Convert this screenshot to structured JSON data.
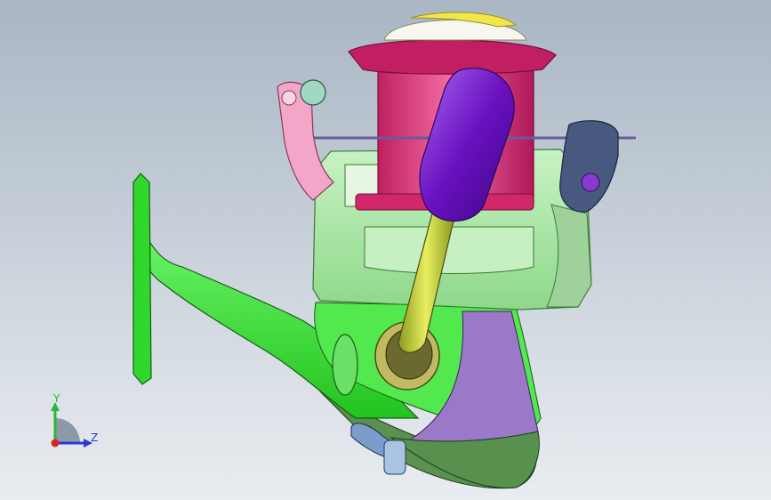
{
  "viewport": {
    "background_top": "#a9b6c4",
    "background_bottom": "#e9edf1"
  },
  "triad": {
    "y_label": "Y",
    "z_label": "Z",
    "y_color": "#2bb53a",
    "z_color": "#2a3ad8",
    "x_color": "#d8242a"
  },
  "parts": {
    "foot": "#2fd82a",
    "stem": "#3cec3a",
    "frame": "#aee8ac",
    "spool": "#d8326e",
    "spool_rim": "#b81e5a",
    "knob": "#7a1ad0",
    "shaft": "#c8d236",
    "bail_arm": "#f2a6c8",
    "bail_lever": "#47597e",
    "gearbox": "#9b78c8",
    "gearbox_bottom": "#58904e",
    "cap": "#f2e64a",
    "lever": "#7c9ccc",
    "pin": "#a9c4e2"
  }
}
